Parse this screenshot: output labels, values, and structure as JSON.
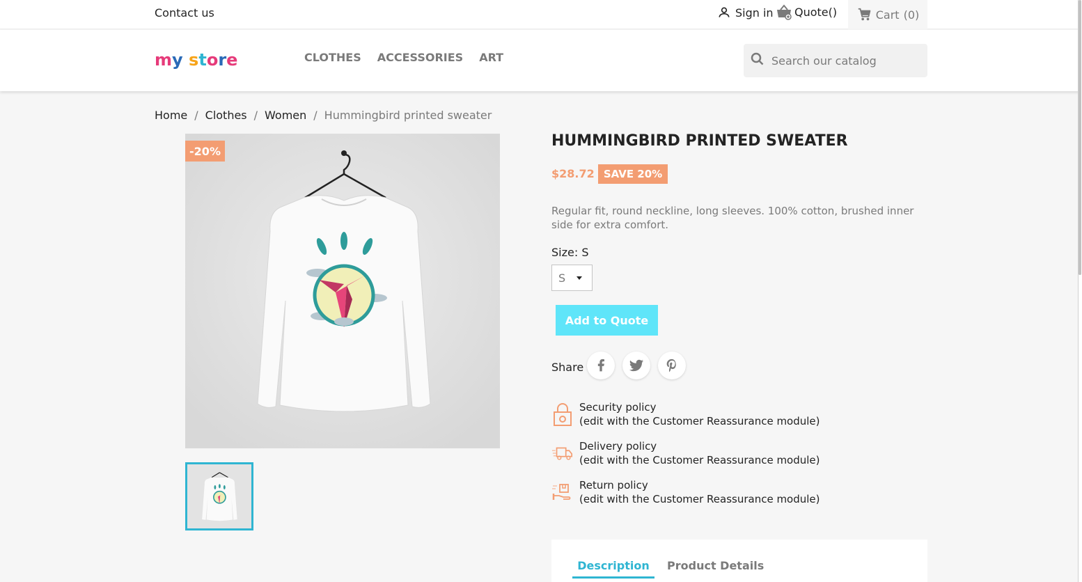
{
  "topbar": {
    "contact": "Contact us",
    "signin": "Sign in",
    "quote": "Quote()",
    "cart": "Cart",
    "cart_count": "(0)"
  },
  "header": {
    "logo": [
      "m",
      "y",
      " ",
      "s",
      "t",
      "o",
      "r",
      "e"
    ],
    "logo_colors": [
      "#e63b7a",
      "#2a6ab7",
      "#ffffff",
      "#f7a41a",
      "#2fb5d2",
      "#e63b7a",
      "#2a6ab7",
      "#e63b7a"
    ],
    "nav": [
      "CLOTHES",
      "ACCESSORIES",
      "ART"
    ],
    "search_placeholder": "Search our catalog"
  },
  "breadcrumb": {
    "items": [
      "Home",
      "Clothes",
      "Women"
    ],
    "current": "Hummingbird printed sweater"
  },
  "product": {
    "discount_badge": "-20%",
    "title": "HUMMINGBIRD PRINTED SWEATER",
    "price": "$28.72",
    "save": "SAVE 20%",
    "description": "Regular fit, round neckline, long sleeves. 100% cotton, brushed inner side for extra comfort.",
    "size_label": "Size: S",
    "size_value": "S",
    "add_to_quote": "Add to Quote",
    "share_label": "Share",
    "social": [
      "facebook-icon",
      "twitter-icon",
      "pinterest-icon"
    ]
  },
  "policies": [
    {
      "icon": "lock-icon",
      "title": "Security policy",
      "note": "(edit with the Customer Reassurance module)"
    },
    {
      "icon": "truck-icon",
      "title": "Delivery policy",
      "note": "(edit with the Customer Reassurance module)"
    },
    {
      "icon": "return-icon",
      "title": "Return policy",
      "note": "(edit with the Customer Reassurance module)"
    }
  ],
  "tabs": {
    "active": "Description",
    "inactive": "Product Details"
  },
  "colors": {
    "accent": "#2fb5d2",
    "discount": "#f39d72",
    "quote_button": "#5fe5f9"
  }
}
